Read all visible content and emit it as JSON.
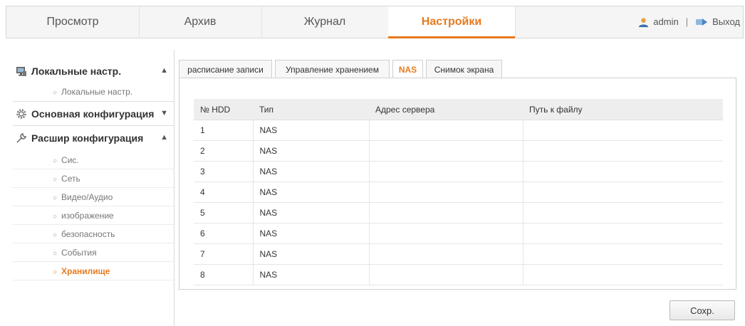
{
  "topnav": {
    "tabs": [
      {
        "label": "Просмотр",
        "active": false
      },
      {
        "label": "Архив",
        "active": false
      },
      {
        "label": "Журнал",
        "active": false
      },
      {
        "label": "Настройки",
        "active": true
      }
    ],
    "user": "admin",
    "separator": "|",
    "logout": "Выход"
  },
  "sidebar": {
    "sections": [
      {
        "label": "Локальные настр.",
        "expanded": true,
        "items": [
          "Локальные настр."
        ]
      },
      {
        "label": "Основная конфигурация",
        "expanded": false,
        "items": []
      },
      {
        "label": "Расшир конфигурация",
        "expanded": true,
        "items": [
          "Сис.",
          "Сеть",
          "Видео/Аудио",
          "изображение",
          "безопасность",
          "События",
          "Хранилище"
        ],
        "active_item": "Хранилище"
      }
    ]
  },
  "subtabs": [
    {
      "label": "расписание записи",
      "active": false
    },
    {
      "label": "Управление хранением",
      "active": false
    },
    {
      "label": "NAS",
      "active": true
    },
    {
      "label": "Снимок экрана",
      "active": false
    }
  ],
  "table": {
    "headers": [
      "№ HDD",
      "Тип",
      "Адрес сервера",
      "Путь к файлу"
    ],
    "rows": [
      [
        "1",
        "NAS",
        "",
        ""
      ],
      [
        "2",
        "NAS",
        "",
        ""
      ],
      [
        "3",
        "NAS",
        "",
        ""
      ],
      [
        "4",
        "NAS",
        "",
        ""
      ],
      [
        "5",
        "NAS",
        "",
        ""
      ],
      [
        "6",
        "NAS",
        "",
        ""
      ],
      [
        "7",
        "NAS",
        "",
        ""
      ],
      [
        "8",
        "NAS",
        "",
        ""
      ]
    ]
  },
  "save_label": "Сохр.",
  "colors": {
    "accent": "#e77a1e",
    "border": "#cfcfcf",
    "header_bg": "#eeeeee"
  },
  "icons": {
    "user": "user-icon",
    "logout": "logout-icon",
    "local": "monitor-icon",
    "basic": "gear-icon",
    "advanced": "wrench-icon"
  }
}
